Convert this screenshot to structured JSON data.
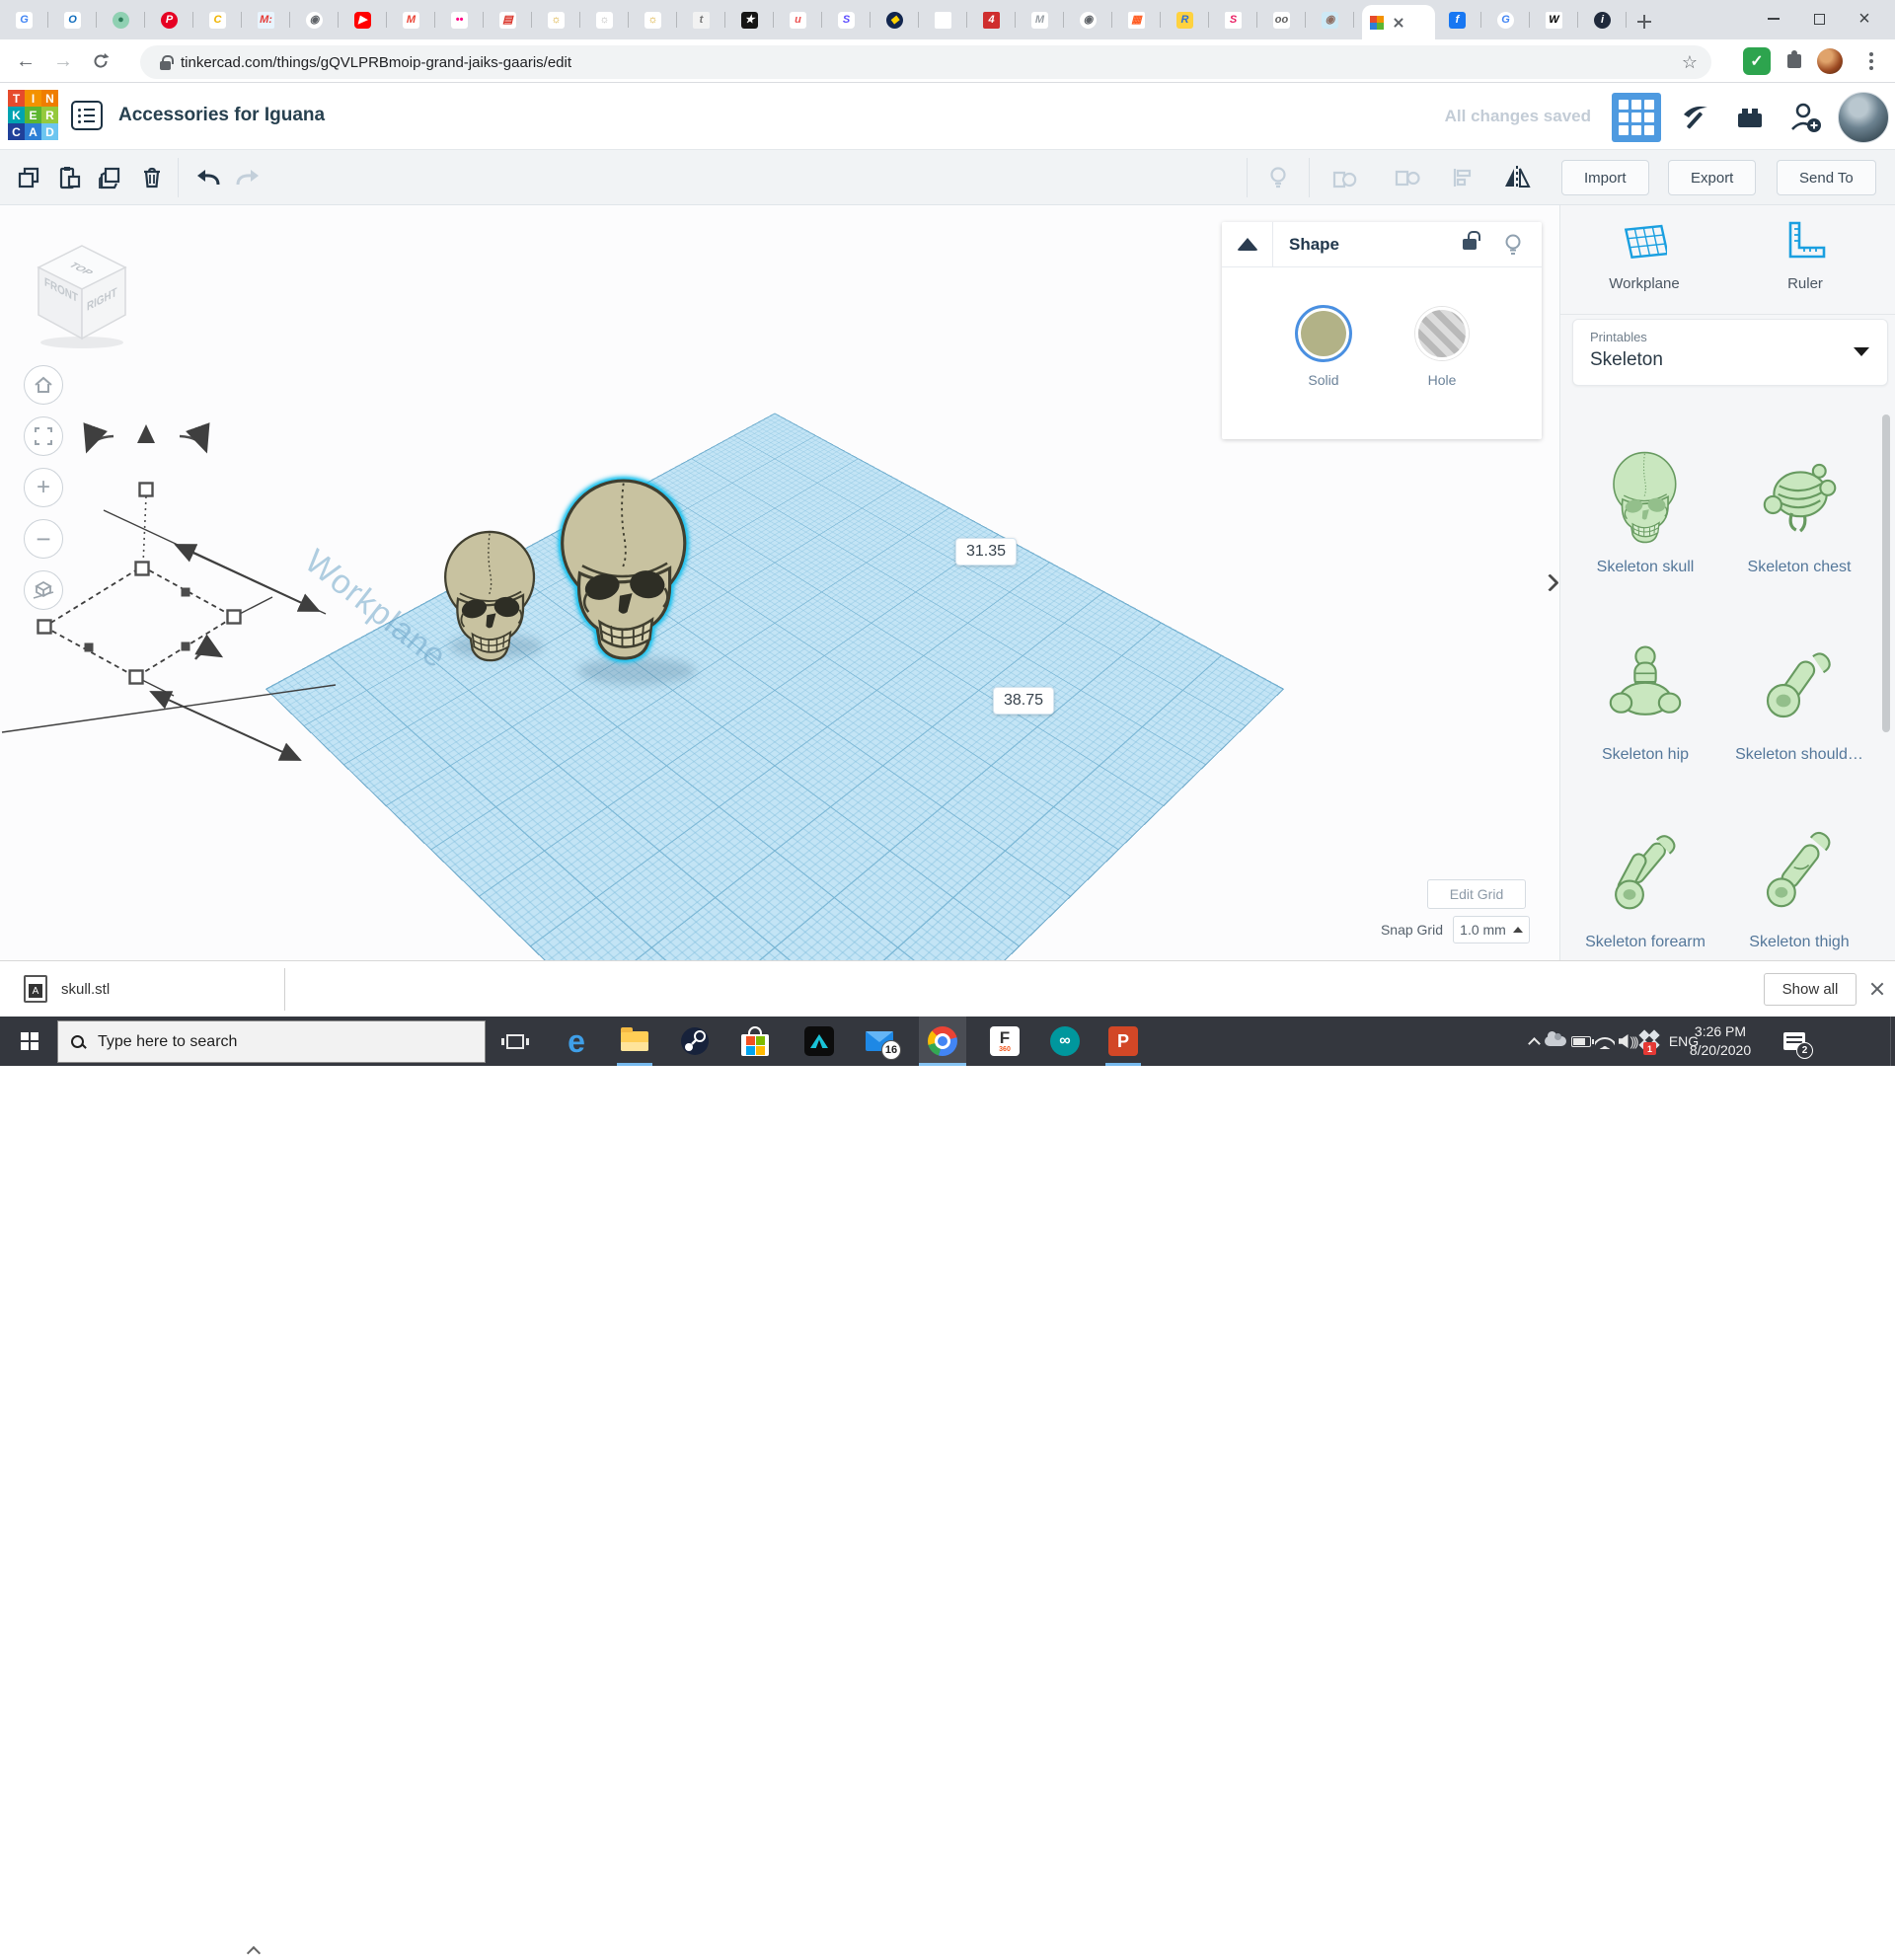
{
  "browser": {
    "url": "tinkercad.com/things/gQVLPRBmoip-grand-jaiks-gaaris/edit",
    "pinned_tabs": [
      {
        "g": "G",
        "fg": "#4285f4",
        "bg": "#ffffff",
        "rd": "3px"
      },
      {
        "g": "O",
        "fg": "#0f6cbd",
        "bg": "#ffffff",
        "rd": "3px"
      },
      {
        "g": "●",
        "fg": "#2e7d5b",
        "bg": "#8fd0b2",
        "rd": "50%"
      },
      {
        "g": "P",
        "fg": "#ffffff",
        "bg": "#e60023",
        "rd": "50%"
      },
      {
        "g": "C",
        "fg": "#f0b400",
        "bg": "#ffffff",
        "rd": "3px"
      },
      {
        "g": "M:",
        "fg": "#e53935",
        "bg": "#e8f4fd",
        "rd": "2px"
      },
      {
        "g": "◉",
        "fg": "#5f6368",
        "bg": "#ffffff",
        "rd": "50%"
      },
      {
        "g": "▶",
        "fg": "#ffffff",
        "bg": "#ff0000",
        "rd": "4px"
      },
      {
        "g": "M",
        "fg": "#ea4335",
        "bg": "#ffffff",
        "rd": "3px"
      },
      {
        "g": "••",
        "fg": "#ff0084",
        "bg": "#ffffff",
        "rd": "3px"
      },
      {
        "g": "▤",
        "fg": "#d93025",
        "bg": "#ffffff",
        "rd": "3px"
      },
      {
        "g": "☼",
        "fg": "#d4a017",
        "bg": "#ffffff",
        "rd": "3px"
      },
      {
        "g": "☼",
        "fg": "#b5b5b5",
        "bg": "#ffffff",
        "rd": "3px"
      },
      {
        "g": "☼",
        "fg": "#d4a017",
        "bg": "#ffffff",
        "rd": "3px"
      },
      {
        "g": "t",
        "fg": "#777777",
        "bg": "#f2f2f2",
        "rd": "2px"
      },
      {
        "g": "★",
        "fg": "#ffffff",
        "bg": "#151515",
        "rd": "3px"
      },
      {
        "g": "u",
        "fg": "#ec5252",
        "bg": "#ffffff",
        "rd": "3px"
      },
      {
        "g": "S",
        "fg": "#5b4cff",
        "bg": "#ffffff",
        "rd": "4px"
      },
      {
        "g": "◆",
        "fg": "#ffd200",
        "bg": "#12264f",
        "rd": "50%"
      },
      {
        "g": "",
        "fg": "#999999",
        "bg": "#ffffff",
        "rd": "2px"
      },
      {
        "g": "4",
        "fg": "#ffffff",
        "bg": "#cf2e2e",
        "rd": "2px"
      },
      {
        "g": "M",
        "fg": "#9aa0a6",
        "bg": "#ffffff",
        "rd": "3px"
      },
      {
        "g": "◉",
        "fg": "#5f6368",
        "bg": "#ffffff",
        "rd": "50%"
      },
      {
        "g": "▦",
        "fg": "#ff5a1f",
        "bg": "#ffffff",
        "rd": "2px"
      },
      {
        "g": "R",
        "fg": "#2f6fd6",
        "bg": "#ffd23f",
        "rd": "3px"
      },
      {
        "g": "S",
        "fg": "#e91e63",
        "bg": "#ffffff",
        "rd": "2px"
      },
      {
        "g": "oo",
        "fg": "#616161",
        "bg": "#ffffff",
        "rd": "3px"
      },
      {
        "g": "◉",
        "fg": "#8d6e63",
        "bg": "#cde9f6",
        "rd": "3px"
      }
    ],
    "post_tabs": [
      {
        "g": "f",
        "fg": "#ffffff",
        "bg": "#1877f2",
        "rd": "3px"
      },
      {
        "g": "G",
        "fg": "#4285f4",
        "bg": "#ffffff",
        "rd": "50%"
      },
      {
        "g": "W",
        "fg": "#000000",
        "bg": "#ffffff",
        "rd": "2px"
      },
      {
        "g": "i",
        "fg": "#ffffff",
        "bg": "#202a3c",
        "rd": "50%"
      }
    ]
  },
  "header": {
    "title": "Accessories for Iguana",
    "saved": "All changes saved",
    "logo": [
      {
        "ch": "T",
        "bg": "#e64b2c"
      },
      {
        "ch": "I",
        "bg": "#f39200"
      },
      {
        "ch": "N",
        "bg": "#ef7d00"
      },
      {
        "ch": "K",
        "bg": "#00a3b1"
      },
      {
        "ch": "E",
        "bg": "#5cb531"
      },
      {
        "ch": "R",
        "bg": "#95c93d"
      },
      {
        "ch": "C",
        "bg": "#20409a"
      },
      {
        "ch": "A",
        "bg": "#2e7fd6"
      },
      {
        "ch": "D",
        "bg": "#6cc5f0"
      }
    ]
  },
  "toolbar": {
    "import": "Import",
    "export": "Export",
    "send_to": "Send To"
  },
  "shape_panel": {
    "title": "Shape",
    "solid": "Solid",
    "hole": "Hole"
  },
  "viewport": {
    "cube_top": "TOP",
    "cube_front": "FRONT",
    "cube_right": "RIGHT",
    "watermark": "Workplane",
    "dim_width": "31.35",
    "dim_depth": "38.75",
    "edit_grid": "Edit Grid",
    "snap_label": "Snap Grid",
    "snap_value": "1.0 mm"
  },
  "sidebar": {
    "workplane": "Workplane",
    "ruler": "Ruler",
    "category_label": "Printables",
    "category_value": "Skeleton",
    "items": [
      {
        "label": "Skeleton skull",
        "sym": "#sym-skull"
      },
      {
        "label": "Skeleton chest",
        "sym": "#sym-chest"
      },
      {
        "label": "Skeleton hip",
        "sym": "#sym-hip"
      },
      {
        "label": "Skeleton should…",
        "sym": "#sym-shoulder"
      },
      {
        "label": "Skeleton forearm",
        "sym": "#sym-forearm"
      },
      {
        "label": "Skeleton thigh",
        "sym": "#sym-thigh"
      }
    ]
  },
  "downloads": {
    "file": "skull.stl",
    "show_all": "Show all"
  },
  "taskbar": {
    "search_placeholder": "Type here to search",
    "lang": "ENG",
    "time": "3:26 PM",
    "date": "8/20/2020",
    "mail_badge": "16",
    "notify_badge": "2",
    "dropbox_badge": "1"
  }
}
